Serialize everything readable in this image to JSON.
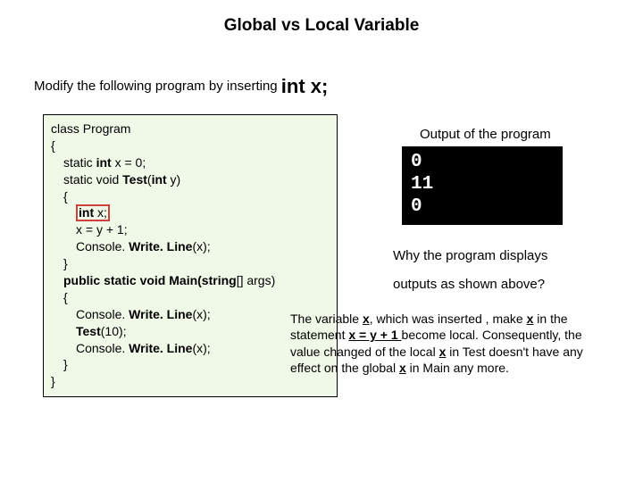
{
  "title": "Global vs Local Variable",
  "intro_prefix": "Modify the following program by inserting ",
  "intro_code": "int x;",
  "code": {
    "l1": "class Program",
    "l2": "{",
    "l3_a": "static ",
    "l3_b": "int",
    "l3_c": " x = 0;",
    "l4_a": "static void ",
    "l4_b": "Test",
    "l4_c": "(",
    "l4_d": "int",
    "l4_e": " y)",
    "l5": "{",
    "l6_a": "int",
    "l6_b": " x;",
    "l7": "x = y + 1;",
    "l8_a": "Console. ",
    "l8_b": "Write. Line",
    "l8_c": "(x);",
    "l9": "}",
    "l10_a": "public static void Main(string",
    "l10_b": "[] args)",
    "l11": "{",
    "l12_a": "Console. ",
    "l12_b": "Write. Line",
    "l12_c": "(x);",
    "l13_a": "Test",
    "l13_b": "(10);",
    "l14_a": "Console. ",
    "l14_b": "Write. Line",
    "l14_c": "(x);",
    "l15": "}",
    "l16": "}"
  },
  "output_label": "Output of the program",
  "output_lines": {
    "o1": "0",
    "o2": "11",
    "o3": "0"
  },
  "question_line1": "Why the program displays",
  "question_line2": "outputs as shown above?",
  "explain": {
    "p1a": "The variable ",
    "p1x": "x",
    "p1b": ", which was inserted , make ",
    "p1x2": "x",
    "p1c": " in the statement ",
    "stmt": "x = y + 1 ",
    "p1d": "become local. Consequently, the value changed of the local ",
    "p1x3": "x",
    "p1e": " in Test doesn't have any effect on the global ",
    "p1x4": "x",
    "p1f": " in Main any more."
  }
}
